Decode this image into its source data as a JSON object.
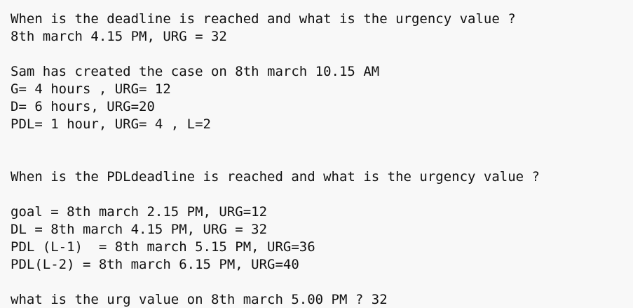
{
  "document": {
    "lines": [
      "When is the deadline is reached and what is the urgency value ?",
      "8th march 4.15 PM, URG = 32",
      "",
      "Sam has created the case on 8th march 10.15 AM",
      "G= 4 hours , URG= 12",
      "D= 6 hours, URG=20",
      "PDL= 1 hour, URG= 4 , L=2",
      "",
      "",
      "When is the PDLdeadline is reached and what is the urgency value ?",
      "",
      "goal = 8th march 2.15 PM, URG=12",
      "DL = 8th march 4.15 PM, URG = 32",
      "PDL (L-1)  = 8th march 5.15 PM, URG=36",
      "PDL(L-2) = 8th march 6.15 PM, URG=40",
      "",
      "what is the urg value on 8th march 5.00 PM ? 32"
    ]
  }
}
